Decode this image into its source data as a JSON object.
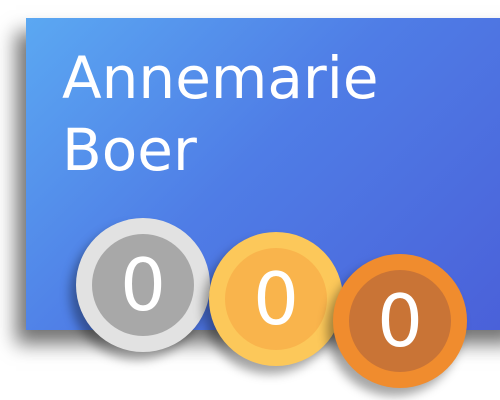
{
  "profile": {
    "first_name": "Annemarie",
    "last_name": "Boer"
  },
  "medals": {
    "silver": {
      "count": "0",
      "color": "#a8a8a8"
    },
    "gold": {
      "count": "0",
      "color": "#f9b44c"
    },
    "bronze": {
      "count": "0",
      "color": "#c97436"
    }
  },
  "colors": {
    "card_gradient_start": "#5ba8f2",
    "card_gradient_end": "#4a5fd8"
  }
}
